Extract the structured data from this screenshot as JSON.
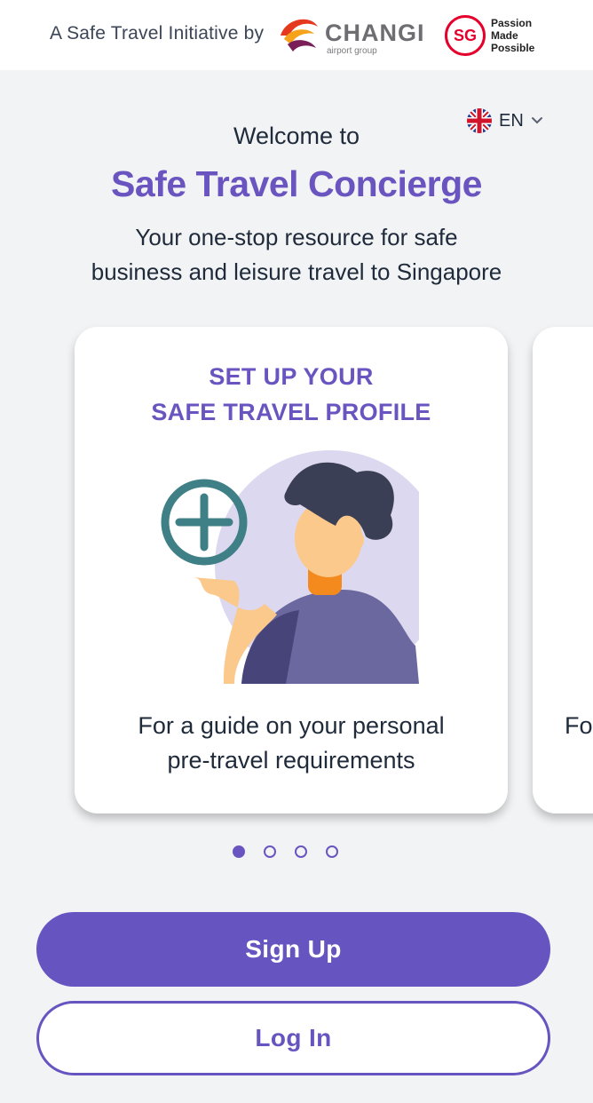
{
  "header": {
    "initiative_text": "A Safe Travel Initiative by",
    "changi_brand": "CHANGI",
    "changi_sub": "airport group",
    "sg_mark": "SG",
    "sg_tagline": [
      "Passion",
      "Made",
      "Possible"
    ]
  },
  "language": {
    "code": "EN",
    "icon": "uk-flag-icon"
  },
  "welcome": {
    "greeting": "Welcome to",
    "app_name": "Safe Travel Concierge",
    "tagline_line1": "Your one-stop resource for safe",
    "tagline_line2": "business and leisure travel to Singapore"
  },
  "carousel": {
    "cards": [
      {
        "title_line1": "SET UP YOUR",
        "title_line2": "SAFE TRAVEL PROFILE",
        "icon": "add-profile-illustration",
        "caption_line1": "For a guide on your personal",
        "caption_line2": "pre-travel requirements"
      }
    ],
    "peek_caption": "Fo",
    "pages": 4,
    "active_page": 1
  },
  "actions": {
    "signup_label": "Sign Up",
    "login_label": "Log In"
  },
  "colors": {
    "accent": "#6655c0",
    "background": "#f2f3f5",
    "teal": "#3f7f86",
    "changi_red": "#e4002b"
  }
}
